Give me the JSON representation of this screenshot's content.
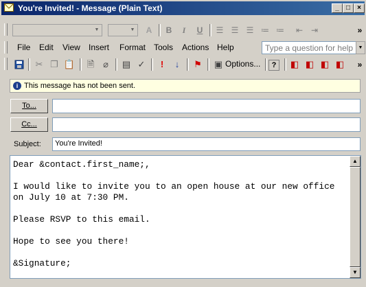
{
  "window": {
    "title": "You're Invited! - Message (Plain Text)",
    "min_glyph": "_",
    "max_glyph": "□",
    "close_glyph": "×"
  },
  "format_toolbar": {
    "bold": "B",
    "italic": "I",
    "underline": "U",
    "overflow": "»"
  },
  "menu": {
    "items": [
      "File",
      "Edit",
      "View",
      "Insert",
      "Format",
      "Tools",
      "Actions",
      "Help"
    ],
    "ask_placeholder": "Type a question for help"
  },
  "std_toolbar": {
    "options_label": "Options...",
    "overflow": "»"
  },
  "infobar": {
    "message": "This message has not been sent."
  },
  "address": {
    "to_label": "To...",
    "cc_label": "Cc...",
    "to_value": "",
    "cc_value": "",
    "subject_label": "Subject:",
    "subject_value": "You're Invited!"
  },
  "body": {
    "text": "Dear &contact.first_name;,\n\nI would like to invite you to an open house at our new office\non July 10 at 7:30 PM.\n\nPlease RSVP to this email.\n\nHope to see you there!\n\n&Signature;"
  },
  "colors": {
    "titlebar_start": "#0a246a",
    "titlebar_end": "#3a6ea5",
    "infobar_bg": "#ffffe1",
    "chrome": "#d4d0c8"
  }
}
